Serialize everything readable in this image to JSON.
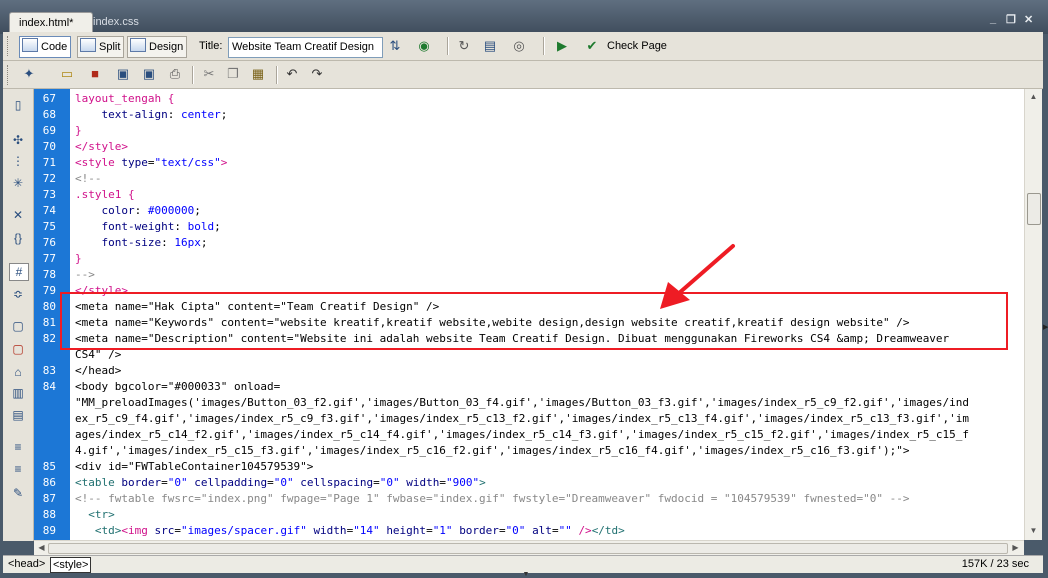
{
  "tabs": [
    {
      "label": "index.html*",
      "active": true
    },
    {
      "label": "index.css",
      "active": false
    }
  ],
  "window_controls": {
    "minimize": "_",
    "restore": "❐",
    "close": "✕"
  },
  "toolbar": {
    "code_label": "Code",
    "split_label": "Split",
    "design_label": "Design",
    "title_label": "Title:",
    "title_value": "Website Team Creatif Design",
    "check_page_label": "Check Page"
  },
  "code_lines": [
    {
      "num": "67",
      "segs": [
        {
          "t": "layout_tengah {",
          "c": "pink"
        }
      ]
    },
    {
      "num": "68",
      "segs": [
        {
          "t": "    text-align",
          "c": "navy"
        },
        {
          "t": ": ",
          "c": "black"
        },
        {
          "t": "center",
          "c": "blue"
        },
        {
          "t": ";",
          "c": "black"
        }
      ]
    },
    {
      "num": "69",
      "segs": [
        {
          "t": "}",
          "c": "pink"
        }
      ]
    },
    {
      "num": "70",
      "segs": [
        {
          "t": "</style>",
          "c": "pink"
        }
      ]
    },
    {
      "num": "71",
      "segs": [
        {
          "t": "<style ",
          "c": "pink"
        },
        {
          "t": "type",
          "c": "navy"
        },
        {
          "t": "=",
          "c": "black"
        },
        {
          "t": "\"text/css\"",
          "c": "blue"
        },
        {
          "t": ">",
          "c": "pink"
        }
      ]
    },
    {
      "num": "72",
      "segs": [
        {
          "t": "<!--",
          "c": "grey"
        }
      ]
    },
    {
      "num": "73",
      "segs": [
        {
          "t": ".style1 {",
          "c": "pink"
        }
      ]
    },
    {
      "num": "74",
      "segs": [
        {
          "t": "    color",
          "c": "navy"
        },
        {
          "t": ": ",
          "c": "black"
        },
        {
          "t": "#000000",
          "c": "blue"
        },
        {
          "t": ";",
          "c": "black"
        }
      ]
    },
    {
      "num": "75",
      "segs": [
        {
          "t": "    font-weight",
          "c": "navy"
        },
        {
          "t": ": ",
          "c": "black"
        },
        {
          "t": "bold",
          "c": "blue"
        },
        {
          "t": ";",
          "c": "black"
        }
      ]
    },
    {
      "num": "76",
      "segs": [
        {
          "t": "    font-size",
          "c": "navy"
        },
        {
          "t": ": ",
          "c": "black"
        },
        {
          "t": "16px",
          "c": "blue"
        },
        {
          "t": ";",
          "c": "black"
        }
      ]
    },
    {
      "num": "77",
      "segs": [
        {
          "t": "}",
          "c": "pink"
        }
      ]
    },
    {
      "num": "78",
      "segs": [
        {
          "t": "-->",
          "c": "grey"
        }
      ]
    },
    {
      "num": "79",
      "segs": [
        {
          "t": "</style>",
          "c": "pink"
        }
      ]
    },
    {
      "num": "80",
      "segs": [
        {
          "t": "<meta name=\"Hak Cipta\" content=\"Team Creatif Design\" />",
          "c": "black"
        }
      ]
    },
    {
      "num": "81",
      "segs": [
        {
          "t": "<meta name=\"Keywords\" content=\"website kreatif,kreatif website,webite design,design website creatif,kreatif design website\" />",
          "c": "black"
        }
      ]
    },
    {
      "num": "82",
      "segs": [
        {
          "t": "<meta name=\"Description\" content=\"Website ini adalah website Team Creatif Design. Dibuat menggunakan Fireworks CS4 &amp; Dreamweaver",
          "c": "black"
        }
      ]
    },
    {
      "num": "",
      "segs": [
        {
          "t": "CS4\" />",
          "c": "black"
        }
      ]
    },
    {
      "num": "83",
      "segs": [
        {
          "t": "</head>",
          "c": "black"
        }
      ]
    },
    {
      "num": "84",
      "segs": [
        {
          "t": "<body bgcolor=\"#000033\" onload=",
          "c": "black"
        }
      ]
    },
    {
      "num": "",
      "segs": [
        {
          "t": "\"MM_preloadImages('images/Button_03_f2.gif','images/Button_03_f4.gif','images/Button_03_f3.gif','images/index_r5_c9_f2.gif','images/ind",
          "c": "black"
        }
      ]
    },
    {
      "num": "",
      "segs": [
        {
          "t": "ex_r5_c9_f4.gif','images/index_r5_c9_f3.gif','images/index_r5_c13_f2.gif','images/index_r5_c13_f4.gif','images/index_r5_c13_f3.gif','im",
          "c": "black"
        }
      ]
    },
    {
      "num": "",
      "segs": [
        {
          "t": "ages/index_r5_c14_f2.gif','images/index_r5_c14_f4.gif','images/index_r5_c14_f3.gif','images/index_r5_c15_f2.gif','images/index_r5_c15_f",
          "c": "black"
        }
      ]
    },
    {
      "num": "",
      "segs": [
        {
          "t": "4.gif','images/index_r5_c15_f3.gif','images/index_r5_c16_f2.gif','images/index_r5_c16_f4.gif','images/index_r5_c16_f3.gif');\">",
          "c": "black"
        }
      ]
    },
    {
      "num": "85",
      "segs": [
        {
          "t": "<div id=\"FWTableContainer104579539\">",
          "c": "black"
        }
      ]
    },
    {
      "num": "86",
      "segs": [
        {
          "t": "<table ",
          "c": "teal"
        },
        {
          "t": "border",
          "c": "navy"
        },
        {
          "t": "=",
          "c": "black"
        },
        {
          "t": "\"0\" ",
          "c": "blue"
        },
        {
          "t": "cellpadding",
          "c": "navy"
        },
        {
          "t": "=",
          "c": "black"
        },
        {
          "t": "\"0\" ",
          "c": "blue"
        },
        {
          "t": "cellspacing",
          "c": "navy"
        },
        {
          "t": "=",
          "c": "black"
        },
        {
          "t": "\"0\" ",
          "c": "blue"
        },
        {
          "t": "width",
          "c": "navy"
        },
        {
          "t": "=",
          "c": "black"
        },
        {
          "t": "\"900\"",
          "c": "blue"
        },
        {
          "t": ">",
          "c": "teal"
        }
      ]
    },
    {
      "num": "87",
      "segs": [
        {
          "t": "<!-- fwtable fwsrc=\"index.png\" fwpage=\"Page 1\" fwbase=\"index.gif\" fwstyle=\"Dreamweaver\" fwdocid = \"104579539\" fwnested=\"0\" -->",
          "c": "grey"
        }
      ]
    },
    {
      "num": "88",
      "segs": [
        {
          "t": "  <tr>",
          "c": "teal"
        }
      ]
    },
    {
      "num": "89",
      "segs": [
        {
          "t": "   <td>",
          "c": "teal"
        },
        {
          "t": "<img ",
          "c": "pink"
        },
        {
          "t": "src",
          "c": "navy"
        },
        {
          "t": "=",
          "c": "black"
        },
        {
          "t": "\"images/spacer.gif\" ",
          "c": "blue"
        },
        {
          "t": "width",
          "c": "navy"
        },
        {
          "t": "=",
          "c": "black"
        },
        {
          "t": "\"14\" ",
          "c": "blue"
        },
        {
          "t": "height",
          "c": "navy"
        },
        {
          "t": "=",
          "c": "black"
        },
        {
          "t": "\"1\" ",
          "c": "blue"
        },
        {
          "t": "border",
          "c": "navy"
        },
        {
          "t": "=",
          "c": "black"
        },
        {
          "t": "\"0\" ",
          "c": "blue"
        },
        {
          "t": "alt",
          "c": "navy"
        },
        {
          "t": "=",
          "c": "black"
        },
        {
          "t": "\"\" ",
          "c": "blue"
        },
        {
          "t": "/>",
          "c": "pink"
        },
        {
          "t": "</td>",
          "c": "teal"
        }
      ]
    }
  ],
  "status_bar": {
    "tags": [
      {
        "label": "<head>",
        "selected": false
      },
      {
        "label": "<style>",
        "selected": true
      }
    ],
    "stats": "157K / 23 sec"
  },
  "colors": {
    "gutter": "#1c77d6",
    "annotation": "#ee1c24"
  }
}
